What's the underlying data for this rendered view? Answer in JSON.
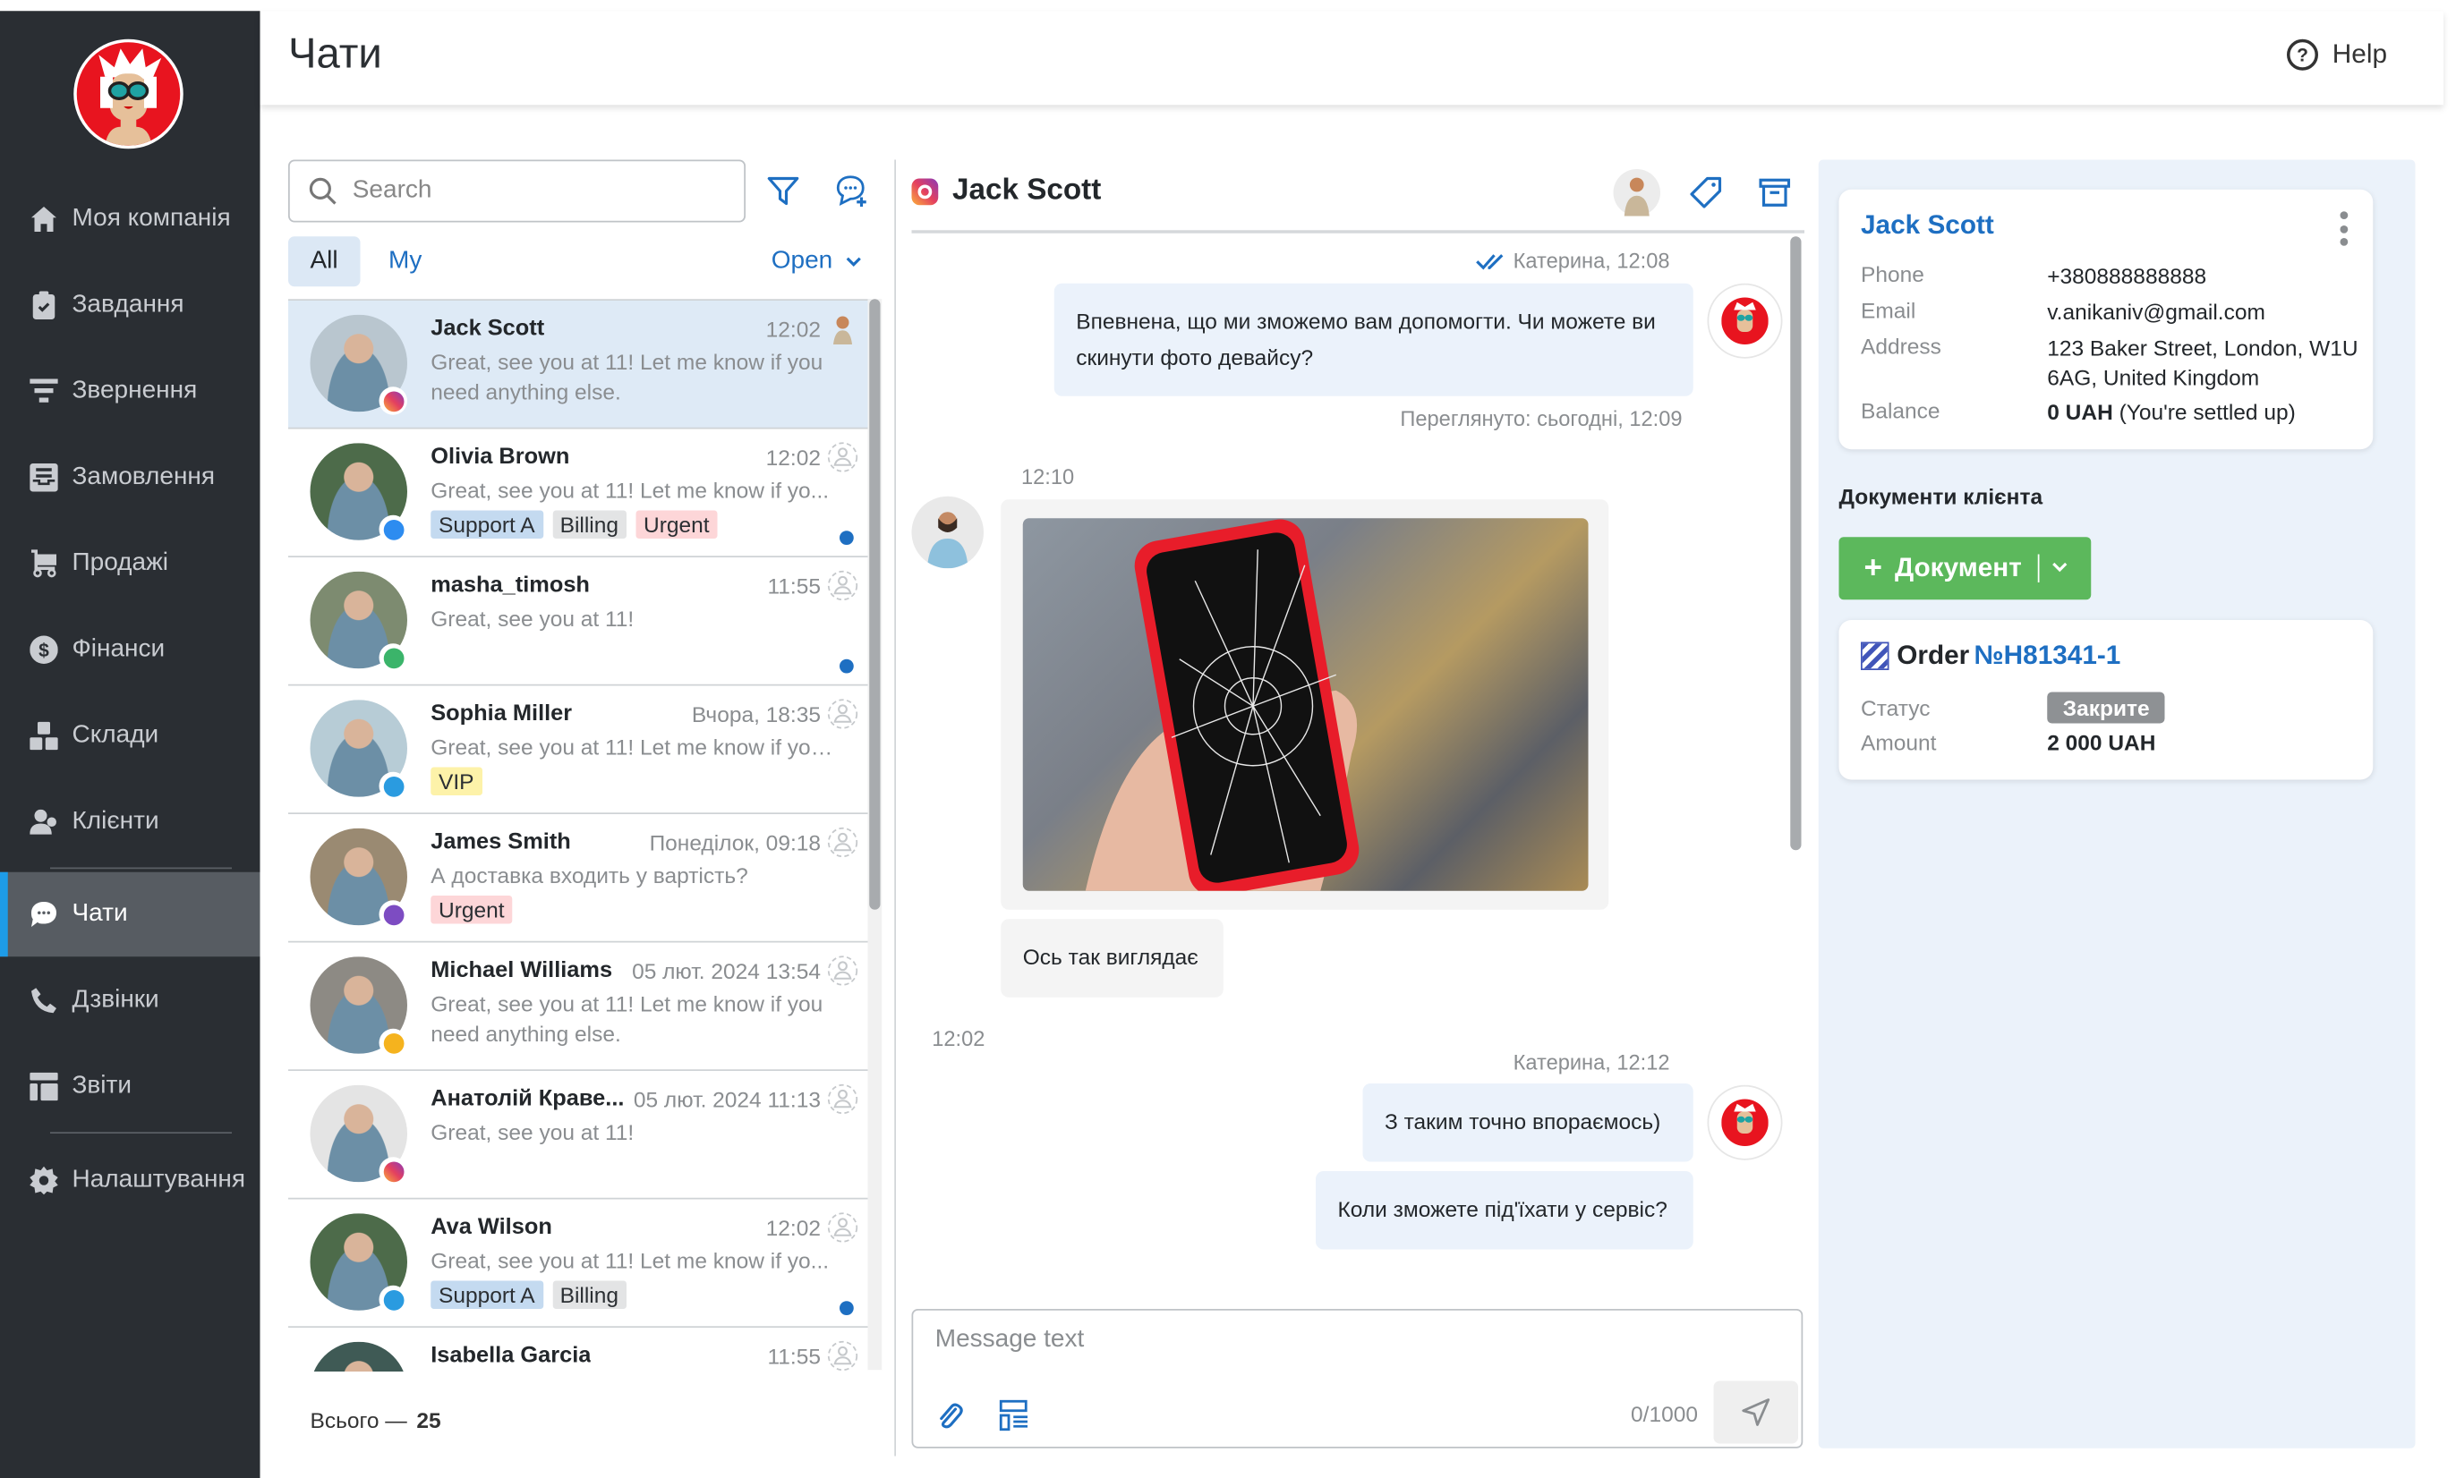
{
  "app": {
    "page_title": "Чати",
    "help_label": "Help"
  },
  "sidebar": {
    "items": [
      {
        "label": "Моя компанія",
        "icon": "home-icon"
      },
      {
        "label": "Завдання",
        "icon": "clipboard-check-icon"
      },
      {
        "label": "Звернення",
        "icon": "funnel-icon"
      },
      {
        "label": "Замовлення",
        "icon": "inbox-icon"
      },
      {
        "label": "Продажі",
        "icon": "cart-icon"
      },
      {
        "label": "Фінанси",
        "icon": "dollar-icon"
      },
      {
        "label": "Склади",
        "icon": "boxes-icon"
      },
      {
        "label": "Клієнти",
        "icon": "users-icon"
      },
      {
        "label": "Чати",
        "icon": "chat-bubble-icon",
        "active": true
      },
      {
        "label": "Дзвінки",
        "icon": "phone-icon"
      },
      {
        "label": "Звіти",
        "icon": "report-table-icon"
      },
      {
        "label": "Налаштування",
        "icon": "gear-icon"
      }
    ]
  },
  "chat_list": {
    "search_placeholder": "Search",
    "tabs": {
      "all": "All",
      "my": "My"
    },
    "status_filter": "Open",
    "total_label": "Всього —",
    "total_count": "25",
    "chats": [
      {
        "name": "Jack Scott",
        "time": "12:02",
        "preview": "Great, see you at 11! Let me know if you need anything else.",
        "channel": "instagram",
        "tags": [],
        "unread": false,
        "selected": true,
        "assigned": true
      },
      {
        "name": "Olivia Brown",
        "time": "12:02",
        "preview": "Great, see you at 11! Let me know if yo...",
        "channel": "messenger",
        "tags": [
          "Support A",
          "Billing",
          "Urgent"
        ],
        "unread": true
      },
      {
        "name": "masha_timosh",
        "time": "11:55",
        "preview": "Great, see you at 11!",
        "channel": "whatsapp",
        "tags": [],
        "unread": true
      },
      {
        "name": "Sophia Miller",
        "time": "Вчора, 18:35",
        "preview": "Great, see you at 11! Let me know if you...",
        "channel": "telegram",
        "tags": [
          "VIP"
        ],
        "unread": false
      },
      {
        "name": "James Smith",
        "time": "Понеділок, 09:18",
        "preview": "А доставка входить у вартість?",
        "channel": "viber",
        "tags": [
          "Urgent"
        ],
        "unread": false
      },
      {
        "name": "Michael Williams",
        "time": "05 лют. 2024 13:54",
        "preview": "Great, see you at 11! Let me know if you need anything else.",
        "channel": "livechat",
        "tags": [],
        "unread": false
      },
      {
        "name": "Анатолій Краве...",
        "time": "05 лют. 2024 11:13",
        "preview": "Great, see you at 11!",
        "channel": "instagram",
        "tags": [],
        "unread": false
      },
      {
        "name": "Ava Wilson",
        "time": "12:02",
        "preview": "Great, see you at 11! Let me know if yo...",
        "channel": "telegram",
        "tags": [
          "Support A",
          "Billing"
        ],
        "unread": true
      },
      {
        "name": "Isabella Garcia",
        "time": "11:55",
        "preview": "",
        "channel": "whatsapp",
        "tags": [],
        "unread": false
      }
    ]
  },
  "conversation": {
    "title": "Jack Scott",
    "channel": "instagram",
    "messages": [
      {
        "dir": "out",
        "meta": "Катерина, 12:08",
        "read": true,
        "text": "Впевнена, що ми зможемо вам допомогти. Чи можете ви скинути фото девайсу?",
        "seen": "Переглянуто: сьогодні, 12:09"
      },
      {
        "dir": "in",
        "meta": "12:10",
        "type": "image",
        "image_alt": "Cracked phone screen photo"
      },
      {
        "dir": "in",
        "text": "Ось так виглядає"
      },
      {
        "dir": "sep",
        "meta": "12:02"
      },
      {
        "dir": "out",
        "meta": "Катерина, 12:12",
        "text": "З таким точно впораємось)"
      },
      {
        "dir": "out",
        "text": "Коли зможете під'їхати у сервіс?"
      }
    ],
    "composer": {
      "placeholder": "Message text",
      "value": "",
      "counter": "0/1000"
    }
  },
  "client": {
    "name": "Jack Scott",
    "fields": [
      {
        "label": "Phone",
        "value": "+380888888888"
      },
      {
        "label": "Email",
        "value": "v.anikaniv@gmail.com"
      },
      {
        "label": "Address",
        "value": "123 Baker Street, London, W1U 6AG, United Kingdom"
      }
    ],
    "balance_label": "Balance",
    "balance_amount": "0 UAH",
    "balance_note": "(You're settled up)",
    "documents_title": "Документи клієнта",
    "add_document_label": "Документ",
    "order": {
      "type": "Order",
      "number": "№H81341-1",
      "status_label": "Статус",
      "status": "Закрите",
      "amount_label": "Amount",
      "amount": "2 000 UAH"
    }
  },
  "colors": {
    "accent": "#1e6fc2",
    "sidebar_bg": "#2a2e33",
    "active_marker": "#1e9ce8",
    "success": "#5cb85c"
  }
}
